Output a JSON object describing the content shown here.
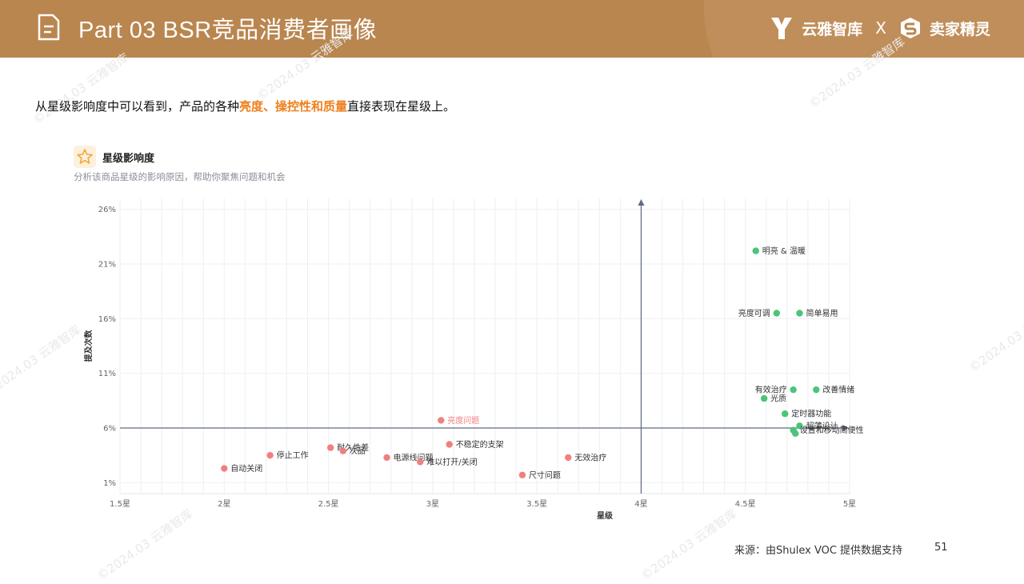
{
  "header": {
    "title": "Part 03  BSR竞品消费者画像",
    "brand_left": "云雅智库",
    "brand_sep": "X",
    "brand_right": "卖家精灵"
  },
  "subtitle": {
    "prefix": "从星级影响度中可以看到，产品的各种",
    "highlight": "亮度、操控性和质量",
    "suffix": "直接表现在星级上。"
  },
  "card": {
    "title": "星级影响度",
    "description": "分析该商品星级的影响原因，帮助你聚焦问题和机会"
  },
  "footer": {
    "source": "来源：由Shulex VOC 提供数据支持",
    "page": "51"
  },
  "watermark": {
    "text": "©2024.03 云雅智库"
  },
  "colors": {
    "header": "#b9864f",
    "highlight": "#f0801e",
    "positive": "#4cc47a",
    "negative": "#f08080",
    "axis": "#5f6a80"
  },
  "chart_data": {
    "type": "scatter",
    "xlabel": "星级",
    "ylabel": "提及次数",
    "xlim": [
      1.5,
      5
    ],
    "ylim": [
      0,
      27
    ],
    "x_ticks": [
      1.5,
      2,
      2.5,
      3,
      3.5,
      4,
      4.5,
      5
    ],
    "x_tick_labels": [
      "1.5星",
      "2星",
      "2.5星",
      "3星",
      "3.5星",
      "4星",
      "4.5星",
      "5星"
    ],
    "y_ticks": [
      1,
      6,
      11,
      16,
      21,
      26
    ],
    "y_tick_labels": [
      "1%",
      "6%",
      "11%",
      "16%",
      "21%",
      "26%"
    ],
    "grid": true,
    "crosshair": {
      "x": 4,
      "y": 6
    },
    "points": [
      {
        "label": "明亮 & 温暖",
        "x": 4.55,
        "y": 22.2,
        "group": "positive",
        "label_side": "right",
        "label_red": false
      },
      {
        "label": "亮度可调",
        "x": 4.65,
        "y": 16.5,
        "group": "positive",
        "label_side": "left",
        "label_red": false
      },
      {
        "label": "简单易用",
        "x": 4.76,
        "y": 16.5,
        "group": "positive",
        "label_side": "right",
        "label_red": false
      },
      {
        "label": "有效治疗",
        "x": 4.73,
        "y": 9.5,
        "group": "positive",
        "label_side": "left",
        "label_red": false
      },
      {
        "label": "改善情绪",
        "x": 4.84,
        "y": 9.5,
        "group": "positive",
        "label_side": "right",
        "label_red": false
      },
      {
        "label": "光质",
        "x": 4.59,
        "y": 8.7,
        "group": "positive",
        "label_side": "right",
        "label_red": false
      },
      {
        "label": "定时器功能",
        "x": 4.69,
        "y": 7.3,
        "group": "positive",
        "label_side": "right",
        "label_red": false
      },
      {
        "label": "超薄设计",
        "x": 4.76,
        "y": 6.2,
        "group": "positive",
        "label_side": "right",
        "label_red": false
      },
      {
        "label": "设置和移动简便性",
        "x": 4.73,
        "y": 5.8,
        "group": "positive",
        "label_side": "right",
        "label_red": false
      },
      {
        "label": "",
        "x": 4.74,
        "y": 5.5,
        "group": "positive",
        "label_side": "right",
        "label_red": false
      },
      {
        "label": "亮度问题",
        "x": 3.04,
        "y": 6.7,
        "group": "negative",
        "label_side": "right",
        "label_red": true
      },
      {
        "label": "不稳定的支架",
        "x": 3.08,
        "y": 4.5,
        "group": "negative",
        "label_side": "right",
        "label_red": false
      },
      {
        "label": "耐久性差",
        "x": 2.51,
        "y": 4.2,
        "group": "negative",
        "label_side": "right",
        "label_red": false
      },
      {
        "label": "次品",
        "x": 2.57,
        "y": 3.9,
        "group": "negative",
        "label_side": "right",
        "label_red": false
      },
      {
        "label": "停止工作",
        "x": 2.22,
        "y": 3.5,
        "group": "negative",
        "label_side": "right",
        "label_red": false
      },
      {
        "label": "电源线问题",
        "x": 2.78,
        "y": 3.3,
        "group": "negative",
        "label_side": "right",
        "label_red": false
      },
      {
        "label": "无效治疗",
        "x": 3.65,
        "y": 3.3,
        "group": "negative",
        "label_side": "right",
        "label_red": false
      },
      {
        "label": "难以打开/关闭",
        "x": 2.94,
        "y": 2.9,
        "group": "negative",
        "label_side": "right",
        "label_red": false
      },
      {
        "label": "自动关闭",
        "x": 2.0,
        "y": 2.3,
        "group": "negative",
        "label_side": "right",
        "label_red": false
      },
      {
        "label": "尺寸问题",
        "x": 3.43,
        "y": 1.7,
        "group": "negative",
        "label_side": "right",
        "label_red": false
      }
    ]
  }
}
